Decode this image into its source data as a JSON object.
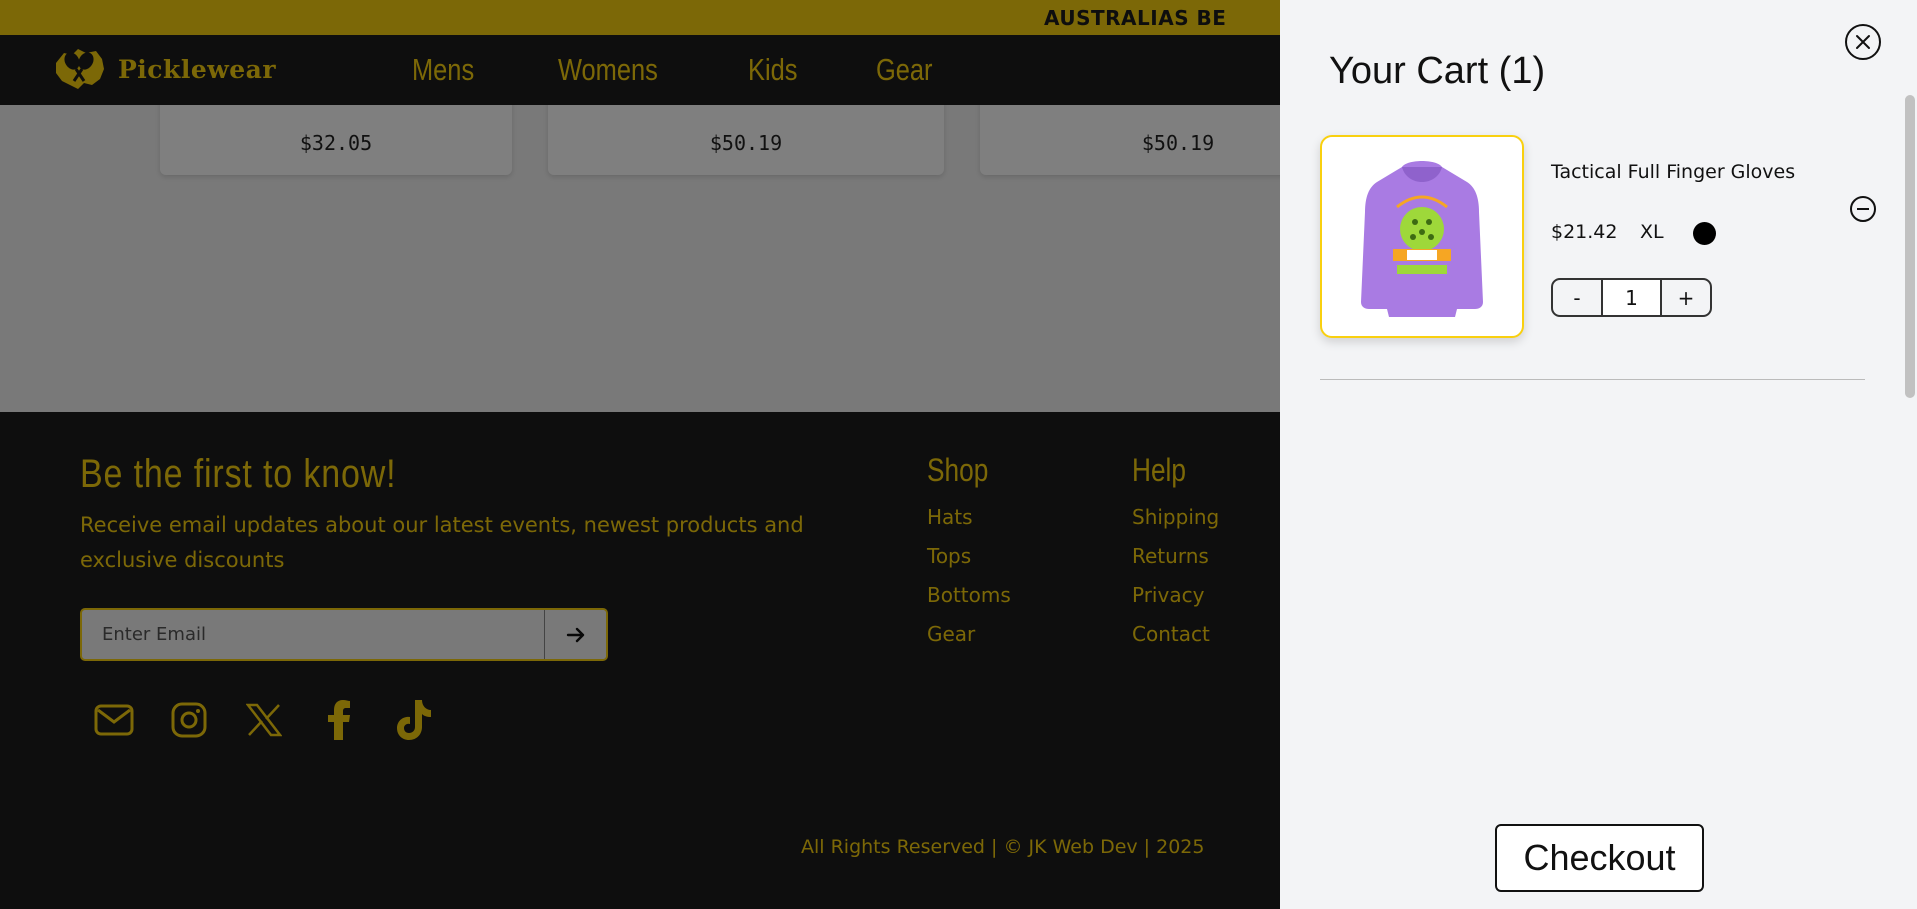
{
  "announcement": {
    "text": "AUSTRALIAS BE"
  },
  "brand": {
    "name": "Picklewear",
    "logo_icon": "crossed-paddles-australia-icon",
    "accent_color": "#f9d00f"
  },
  "nav": {
    "items": [
      "Mens",
      "Womens",
      "Kids",
      "Gear"
    ]
  },
  "products": {
    "prices": [
      "$32.05",
      "$50.19",
      "$50.19"
    ]
  },
  "newsletter": {
    "title": "Be the first to know!",
    "description": "Receive email updates about our latest events, newest products and exclusive discounts",
    "email_placeholder": "Enter Email",
    "submit_icon": "arrow-right-icon"
  },
  "socials": [
    "mail-icon",
    "instagram-icon",
    "x-icon",
    "facebook-icon",
    "tiktok-icon"
  ],
  "footer": {
    "shop": {
      "title": "Shop",
      "links": [
        "Hats",
        "Tops",
        "Bottoms",
        "Gear"
      ]
    },
    "help": {
      "title": "Help",
      "links": [
        "Shipping",
        "Returns",
        "Privacy",
        "Contact"
      ]
    },
    "copyright": "All Rights Reserved | © JK Web Dev | 2025"
  },
  "cart": {
    "title": "Your Cart (1)",
    "item": {
      "name": "Tactical Full Finger Gloves",
      "price": "$21.42",
      "size": "XL",
      "color": "#000000",
      "quantity": "1",
      "image_icon": "purple-hoodie-image"
    },
    "decrement_label": "-",
    "increment_label": "+",
    "checkout_label": "Checkout"
  }
}
